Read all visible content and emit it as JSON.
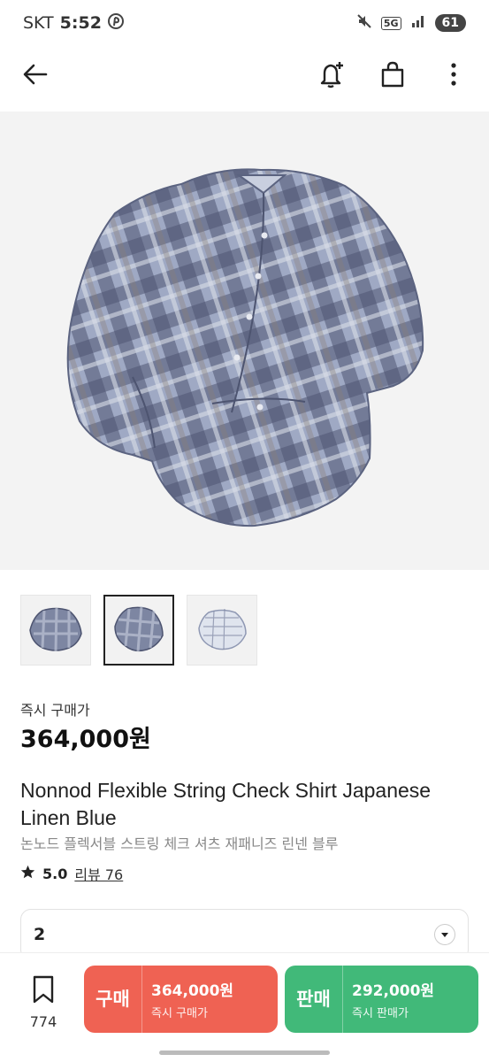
{
  "status_bar": {
    "carrier": "SKT",
    "time": "5:52",
    "network": "5G",
    "battery": "61"
  },
  "icons": {
    "back": "arrow-left-icon",
    "alert": "bell-plus-icon",
    "bag": "shopping-bag-icon",
    "more": "more-vertical-icon",
    "bookmark": "bookmark-icon",
    "chevron": "chevron-down-icon"
  },
  "product": {
    "price_label": "즉시 구매가",
    "price": "364,000원",
    "title_en": "Nonnod Flexible String Check Shirt Japanese Linen Blue",
    "title_ko": "논노드 플렉서블 스트링 체크 셔츠 재패니즈 린넨 블루",
    "rating": "5.0",
    "review_label": "리뷰 76"
  },
  "size_select": {
    "value": "2"
  },
  "bottom_bar": {
    "wish_count": "774",
    "buy": {
      "label": "구매",
      "amount": "364,000원",
      "sub": "즉시 구매가"
    },
    "sell": {
      "label": "판매",
      "amount": "292,000원",
      "sub": "즉시 판매가"
    }
  },
  "colors": {
    "buy": "#ef6253",
    "sell": "#41b979",
    "text": "#222222"
  }
}
